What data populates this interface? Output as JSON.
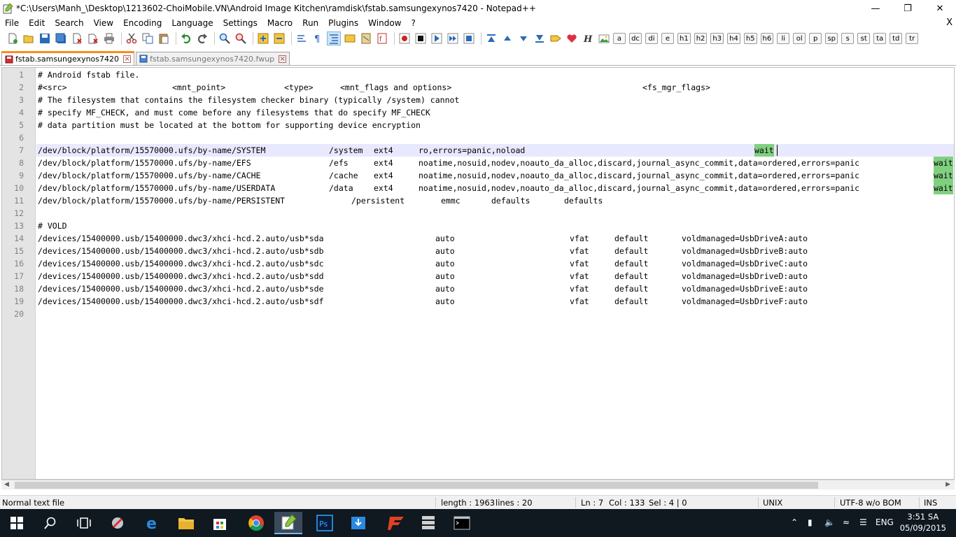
{
  "window": {
    "title": "*C:\\Users\\Manh_\\Desktop\\1213602-ChoiMobile.VN\\Android Image Kitchen\\ramdisk\\fstab.samsungexynos7420 - Notepad++",
    "minimize": "—",
    "maximize": "❐",
    "close": "✕"
  },
  "menu": {
    "items": [
      "File",
      "Edit",
      "Search",
      "View",
      "Encoding",
      "Language",
      "Settings",
      "Macro",
      "Run",
      "Plugins",
      "Window",
      "?"
    ],
    "close_doc": "X"
  },
  "toolbar": {
    "text_buttons": [
      "a",
      "dc",
      "di",
      "e",
      "h1",
      "h2",
      "h3",
      "h4",
      "h5",
      "h6",
      "li",
      "ol",
      "p",
      "sp",
      "s",
      "st",
      "ta",
      "td",
      "tr"
    ]
  },
  "tabs": [
    {
      "label": "fstab.samsungexynos7420",
      "active": true,
      "modified": true
    },
    {
      "label": "fstab.samsungexynos7420.fwup",
      "active": false,
      "modified": false
    }
  ],
  "editor": {
    "current_line": 7,
    "lines": [
      {
        "n": "1",
        "segs": [
          {
            "c": 0,
            "t": "# Android fstab file."
          }
        ]
      },
      {
        "n": "2",
        "segs": [
          {
            "c": 0,
            "t": "#<src>"
          },
          {
            "c": 24,
            "t": "<mnt_point>"
          },
          {
            "c": 44,
            "t": "<type>"
          },
          {
            "c": 54,
            "t": "<mnt_flags and options>"
          },
          {
            "c": 108,
            "t": "<fs_mgr_flags>"
          }
        ]
      },
      {
        "n": "3",
        "segs": [
          {
            "c": 0,
            "t": "# The filesystem that contains the filesystem checker binary (typically /system) cannot"
          }
        ]
      },
      {
        "n": "4",
        "segs": [
          {
            "c": 0,
            "t": "# specify MF_CHECK, and must come before any filesystems that do specify MF_CHECK"
          }
        ]
      },
      {
        "n": "5",
        "segs": [
          {
            "c": 0,
            "t": "# data partition must be located at the bottom for supporting device encryption"
          }
        ]
      },
      {
        "n": "6",
        "segs": []
      },
      {
        "n": "7",
        "segs": [
          {
            "c": 0,
            "t": "/dev/block/platform/15570000.ufs/by-name/SYSTEM"
          },
          {
            "c": 52,
            "t": "/system"
          },
          {
            "c": 60,
            "t": "ext4"
          },
          {
            "c": 68,
            "t": "ro,errors=panic,noload"
          },
          {
            "c": 128,
            "t": "wait",
            "hl": true
          }
        ]
      },
      {
        "n": "8",
        "segs": [
          {
            "c": 0,
            "t": "/dev/block/platform/15570000.ufs/by-name/EFS"
          },
          {
            "c": 52,
            "t": "/efs"
          },
          {
            "c": 60,
            "t": "ext4"
          },
          {
            "c": 68,
            "t": "noatime,nosuid,nodev,noauto_da_alloc,discard,journal_async_commit,data=ordered,errors=panic"
          },
          {
            "c": 160,
            "t": "wait",
            "hl": true
          }
        ]
      },
      {
        "n": "9",
        "segs": [
          {
            "c": 0,
            "t": "/dev/block/platform/15570000.ufs/by-name/CACHE"
          },
          {
            "c": 52,
            "t": "/cache"
          },
          {
            "c": 60,
            "t": "ext4"
          },
          {
            "c": 68,
            "t": "noatime,nosuid,nodev,noauto_da_alloc,discard,journal_async_commit,data=ordered,errors=panic"
          },
          {
            "c": 160,
            "t": "wait",
            "hl": true
          }
        ]
      },
      {
        "n": "10",
        "segs": [
          {
            "c": 0,
            "t": "/dev/block/platform/15570000.ufs/by-name/USERDATA"
          },
          {
            "c": 52,
            "t": "/data"
          },
          {
            "c": 60,
            "t": "ext4"
          },
          {
            "c": 68,
            "t": "noatime,nosuid,nodev,noauto_da_alloc,discard,journal_async_commit,data=ordered,errors=panic"
          },
          {
            "c": 160,
            "t": "wait",
            "hl": true
          }
        ]
      },
      {
        "n": "11",
        "segs": [
          {
            "c": 0,
            "t": "/dev/block/platform/15570000.ufs/by-name/PERSISTENT"
          },
          {
            "c": 56,
            "t": "/persistent"
          },
          {
            "c": 72,
            "t": "emmc"
          },
          {
            "c": 81,
            "t": "defaults"
          },
          {
            "c": 94,
            "t": "defaults"
          }
        ]
      },
      {
        "n": "12",
        "segs": []
      },
      {
        "n": "13",
        "segs": [
          {
            "c": 0,
            "t": "# VOLD"
          }
        ]
      },
      {
        "n": "14",
        "segs": [
          {
            "c": 0,
            "t": "/devices/15400000.usb/15400000.dwc3/xhci-hcd.2.auto/usb*sda"
          },
          {
            "c": 71,
            "t": "auto"
          },
          {
            "c": 95,
            "t": "vfat"
          },
          {
            "c": 103,
            "t": "default"
          },
          {
            "c": 115,
            "t": "voldmanaged=UsbDriveA:auto"
          }
        ]
      },
      {
        "n": "15",
        "segs": [
          {
            "c": 0,
            "t": "/devices/15400000.usb/15400000.dwc3/xhci-hcd.2.auto/usb*sdb"
          },
          {
            "c": 71,
            "t": "auto"
          },
          {
            "c": 95,
            "t": "vfat"
          },
          {
            "c": 103,
            "t": "default"
          },
          {
            "c": 115,
            "t": "voldmanaged=UsbDriveB:auto"
          }
        ]
      },
      {
        "n": "16",
        "segs": [
          {
            "c": 0,
            "t": "/devices/15400000.usb/15400000.dwc3/xhci-hcd.2.auto/usb*sdc"
          },
          {
            "c": 71,
            "t": "auto"
          },
          {
            "c": 95,
            "t": "vfat"
          },
          {
            "c": 103,
            "t": "default"
          },
          {
            "c": 115,
            "t": "voldmanaged=UsbDriveC:auto"
          }
        ]
      },
      {
        "n": "17",
        "segs": [
          {
            "c": 0,
            "t": "/devices/15400000.usb/15400000.dwc3/xhci-hcd.2.auto/usb*sdd"
          },
          {
            "c": 71,
            "t": "auto"
          },
          {
            "c": 95,
            "t": "vfat"
          },
          {
            "c": 103,
            "t": "default"
          },
          {
            "c": 115,
            "t": "voldmanaged=UsbDriveD:auto"
          }
        ]
      },
      {
        "n": "18",
        "segs": [
          {
            "c": 0,
            "t": "/devices/15400000.usb/15400000.dwc3/xhci-hcd.2.auto/usb*sde"
          },
          {
            "c": 71,
            "t": "auto"
          },
          {
            "c": 95,
            "t": "vfat"
          },
          {
            "c": 103,
            "t": "default"
          },
          {
            "c": 115,
            "t": "voldmanaged=UsbDriveE:auto"
          }
        ]
      },
      {
        "n": "19",
        "segs": [
          {
            "c": 0,
            "t": "/devices/15400000.usb/15400000.dwc3/xhci-hcd.2.auto/usb*sdf"
          },
          {
            "c": 71,
            "t": "auto"
          },
          {
            "c": 95,
            "t": "vfat"
          },
          {
            "c": 103,
            "t": "default"
          },
          {
            "c": 115,
            "t": "voldmanaged=UsbDriveF:auto"
          }
        ]
      },
      {
        "n": "20",
        "segs": []
      }
    ]
  },
  "status": {
    "file_type": "Normal text file",
    "length": "length : 1963",
    "lines": "lines : 20",
    "ln": "Ln : 7",
    "col": "Col : 133",
    "sel": "Sel : 4 | 0",
    "eol": "UNIX",
    "encoding": "UTF-8 w/o BOM",
    "mode": "INS"
  },
  "taskbar": {
    "lang": "ENG",
    "time": "3:51 SA",
    "date": "05/09/2015"
  },
  "colors": {
    "taskbar": "#101820",
    "current_line": "#e8e8ff",
    "smart_highlight": "#80d080",
    "tab_accent": "#fa8c1e"
  }
}
